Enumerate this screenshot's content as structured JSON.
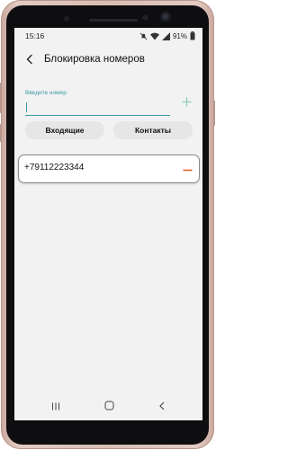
{
  "status_bar": {
    "time": "15:16",
    "battery": "91%"
  },
  "header": {
    "title": "Блокировка номеров"
  },
  "number_input": {
    "hint": "Введите номер",
    "value": ""
  },
  "buttons": {
    "incoming": "Входящие",
    "contacts": "Контакты"
  },
  "blocked_numbers": [
    {
      "number": "+79112223344"
    }
  ],
  "colors": {
    "accent": "#3b98a8",
    "add_icon": "#8ccfb9",
    "remove_icon": "#e05a2b",
    "phone_body": "#d9bdb3"
  },
  "icons": {
    "back": "arrow-left-icon",
    "add": "plus-icon",
    "remove": "minus-icon"
  }
}
